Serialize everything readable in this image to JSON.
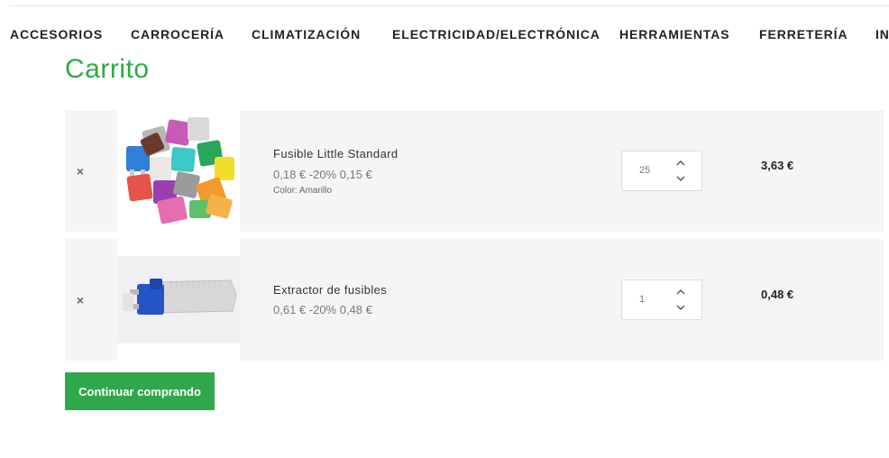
{
  "nav": {
    "items": [
      {
        "label": "ACCESORIOS"
      },
      {
        "label": "CARROCERÍA"
      },
      {
        "label": "CLIMATIZACIÓN"
      },
      {
        "label": "ELECTRICIDAD/ELECTRÓNICA"
      },
      {
        "label": "HERRAMIENTAS"
      },
      {
        "label": "FERRETERÍA"
      },
      {
        "label": "IN"
      }
    ]
  },
  "page": {
    "title": "Carrito"
  },
  "cart": {
    "items": [
      {
        "remove_label": "×",
        "image_icon": "fuses-product-image",
        "name": "Fusible Little Standard",
        "price": "0,18 € -20% 0,15 €",
        "attribute": "Color: Amarillo",
        "quantity": "25",
        "total": "3,63 €"
      },
      {
        "remove_label": "×",
        "image_icon": "fuse-extractor-product-image",
        "name": "Extractor de fusibles",
        "price": "0,61 € -20% 0,48 €",
        "quantity": "1",
        "total": "0,48 €"
      }
    ]
  },
  "actions": {
    "continue_label": "Continuar comprando"
  },
  "colors": {
    "accent": "#2eab44",
    "button": "#2ea84a",
    "row_bg": "#f5f5f5"
  }
}
